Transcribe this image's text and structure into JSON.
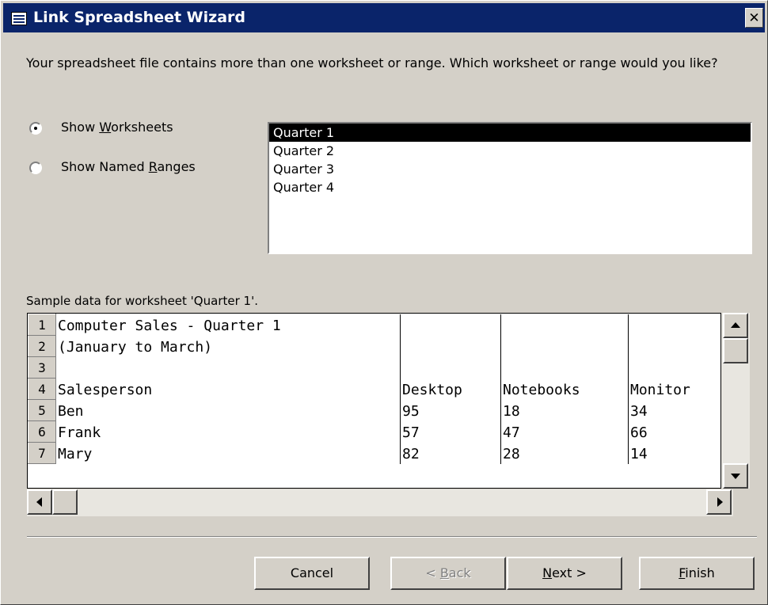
{
  "window": {
    "title": "Link Spreadsheet Wizard",
    "close_glyph": "✕"
  },
  "prompt": "Your spreadsheet file contains more than one worksheet or range. Which worksheet or range would you like?",
  "options": [
    {
      "pre": "Show ",
      "accel": "W",
      "post": "orksheets",
      "selected": true
    },
    {
      "pre": "Show Named ",
      "accel": "R",
      "post": "anges",
      "selected": false
    }
  ],
  "worksheets": [
    "Quarter 1",
    "Quarter 2",
    "Quarter 3",
    "Quarter 4"
  ],
  "selected_worksheet": "Quarter 1",
  "sample_label": "Sample data for worksheet 'Quarter 1'.",
  "sample_rows": [
    {
      "n": "1",
      "c": [
        "Computer Sales - Quarter 1",
        "",
        "",
        ""
      ]
    },
    {
      "n": "2",
      "c": [
        "(January to March)",
        "",
        "",
        ""
      ]
    },
    {
      "n": "3",
      "c": [
        "",
        "",
        "",
        ""
      ]
    },
    {
      "n": "4",
      "c": [
        "Salesperson",
        "Desktop",
        "Notebooks",
        "Monitor"
      ]
    },
    {
      "n": "5",
      "c": [
        "Ben",
        "95",
        "18",
        "34"
      ]
    },
    {
      "n": "6",
      "c": [
        "Frank",
        "57",
        "47",
        "66"
      ]
    },
    {
      "n": "7",
      "c": [
        "Mary",
        "82",
        "28",
        "14"
      ]
    }
  ],
  "buttons": {
    "cancel": {
      "pre": "Cancel",
      "accel": "",
      "post": ""
    },
    "back": {
      "pre": "< ",
      "accel": "B",
      "post": "ack"
    },
    "next": {
      "pre": "",
      "accel": "N",
      "post": "ext >"
    },
    "finish": {
      "pre": "",
      "accel": "F",
      "post": "inish"
    }
  }
}
